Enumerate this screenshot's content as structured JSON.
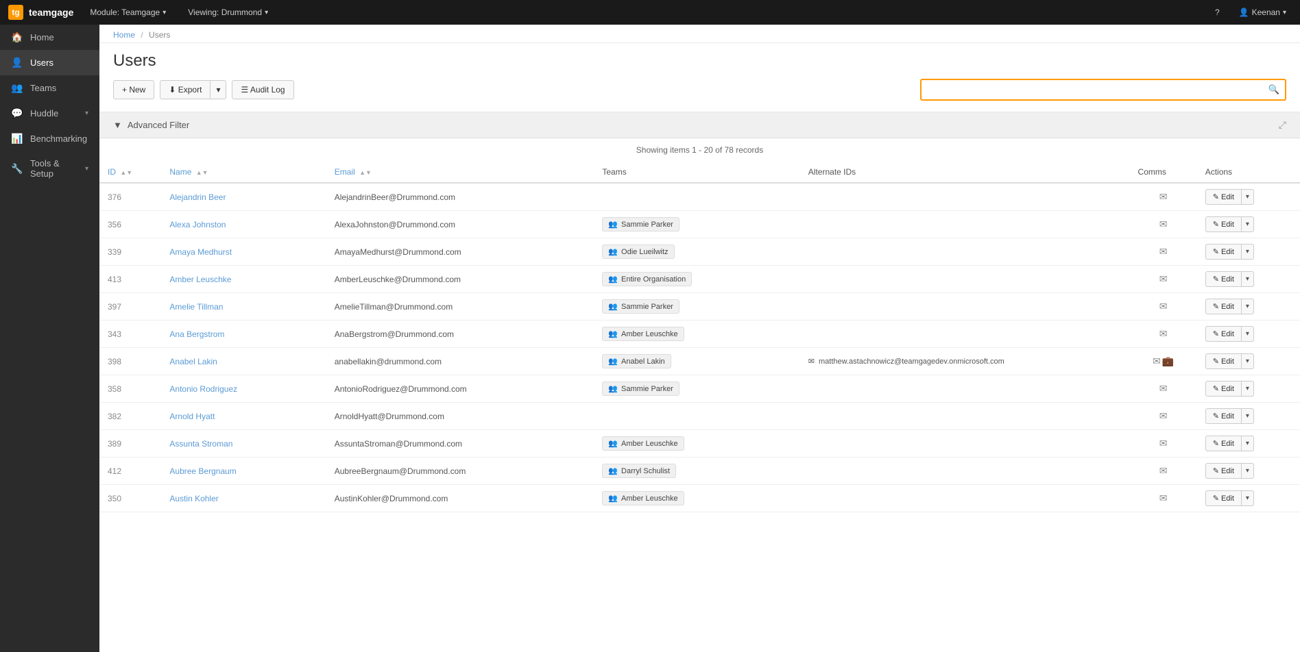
{
  "app": {
    "brand": "teamgage",
    "module_label": "Module: Teamgage",
    "viewing_label": "Viewing: Drummond",
    "user_label": "Keenan",
    "help_icon": "?",
    "chevron": "▾"
  },
  "sidebar": {
    "items": [
      {
        "id": "home",
        "icon": "🏠",
        "label": "Home",
        "active": false
      },
      {
        "id": "users",
        "icon": "👤",
        "label": "Users",
        "active": true
      },
      {
        "id": "teams",
        "icon": "👥",
        "label": "Teams",
        "active": false
      },
      {
        "id": "huddle",
        "icon": "💬",
        "label": "Huddle",
        "active": false,
        "has_sub": true
      },
      {
        "id": "benchmarking",
        "icon": "📊",
        "label": "Benchmarking",
        "active": false
      },
      {
        "id": "tools",
        "icon": "🔧",
        "label": "Tools & Setup",
        "active": false,
        "has_sub": true
      }
    ]
  },
  "breadcrumb": {
    "home": "Home",
    "current": "Users"
  },
  "page": {
    "title": "Users"
  },
  "toolbar": {
    "new_label": "+ New",
    "export_label": "⬇ Export",
    "audit_label": "☰ Audit Log",
    "search_placeholder": ""
  },
  "filter": {
    "label": "Advanced Filter",
    "expand_icon": "⤢"
  },
  "table": {
    "records_info": "Showing items 1 - 20 of 78 records",
    "columns": {
      "id": "ID",
      "name": "Name",
      "email": "Email",
      "teams": "Teams",
      "alt_ids": "Alternate IDs",
      "comms": "Comms",
      "actions": "Actions"
    },
    "rows": [
      {
        "id": "376",
        "name": "Alejandrin Beer",
        "email": "AlejandrinBeer@Drummond.com",
        "teams": [],
        "alt_ids": [],
        "comms": "email",
        "ms": false
      },
      {
        "id": "356",
        "name": "Alexa Johnston",
        "email": "AlexaJohnston@Drummond.com",
        "teams": [
          "Sammie Parker"
        ],
        "alt_ids": [],
        "comms": "email",
        "ms": false
      },
      {
        "id": "339",
        "name": "Amaya Medhurst",
        "email": "AmayaMedhurst@Drummond.com",
        "teams": [
          "Odie Lueilwitz"
        ],
        "alt_ids": [],
        "comms": "email",
        "ms": false
      },
      {
        "id": "413",
        "name": "Amber Leuschke",
        "email": "AmberLeuschke@Drummond.com",
        "teams": [
          "Entire Organisation"
        ],
        "alt_ids": [],
        "comms": "email",
        "ms": false
      },
      {
        "id": "397",
        "name": "Amelie Tillman",
        "email": "AmelieTillman@Drummond.com",
        "teams": [
          "Sammie Parker"
        ],
        "alt_ids": [],
        "comms": "email",
        "ms": false
      },
      {
        "id": "343",
        "name": "Ana Bergstrom",
        "email": "AnaBergstrom@Drummond.com",
        "teams": [
          "Amber Leuschke"
        ],
        "alt_ids": [],
        "comms": "email",
        "ms": false
      },
      {
        "id": "398",
        "name": "Anabel Lakin",
        "email": "anabellakin@drummond.com",
        "teams": [
          "Anabel Lakin"
        ],
        "alt_ids": [
          "matthew.astachnowicz@teamgagedev.onmicrosoft.com"
        ],
        "comms": "email",
        "ms": true
      },
      {
        "id": "358",
        "name": "Antonio Rodriguez",
        "email": "AntonioRodriguez@Drummond.com",
        "teams": [
          "Sammie Parker"
        ],
        "alt_ids": [],
        "comms": "email",
        "ms": false
      },
      {
        "id": "382",
        "name": "Arnold Hyatt",
        "email": "ArnoldHyatt@Drummond.com",
        "teams": [],
        "alt_ids": [],
        "comms": "email",
        "ms": false
      },
      {
        "id": "389",
        "name": "Assunta Stroman",
        "email": "AssuntaStroman@Drummond.com",
        "teams": [
          "Amber Leuschke"
        ],
        "alt_ids": [],
        "comms": "email",
        "ms": false
      },
      {
        "id": "412",
        "name": "Aubree Bergnaum",
        "email": "AubreeBergnaum@Drummond.com",
        "teams": [
          "Darryl Schulist"
        ],
        "alt_ids": [],
        "comms": "email",
        "ms": false
      },
      {
        "id": "350",
        "name": "Austin Kohler",
        "email": "AustinKohler@Drummond.com",
        "teams": [
          "Amber Leuschke"
        ],
        "alt_ids": [],
        "comms": "email",
        "ms": false
      }
    ],
    "edit_label": "✎ Edit",
    "dropdown_arrow": "▾"
  },
  "colors": {
    "accent": "#f90",
    "link": "#5b9bd5",
    "sidebar_bg": "#2b2b2b",
    "topnav_bg": "#1a1a1a"
  }
}
